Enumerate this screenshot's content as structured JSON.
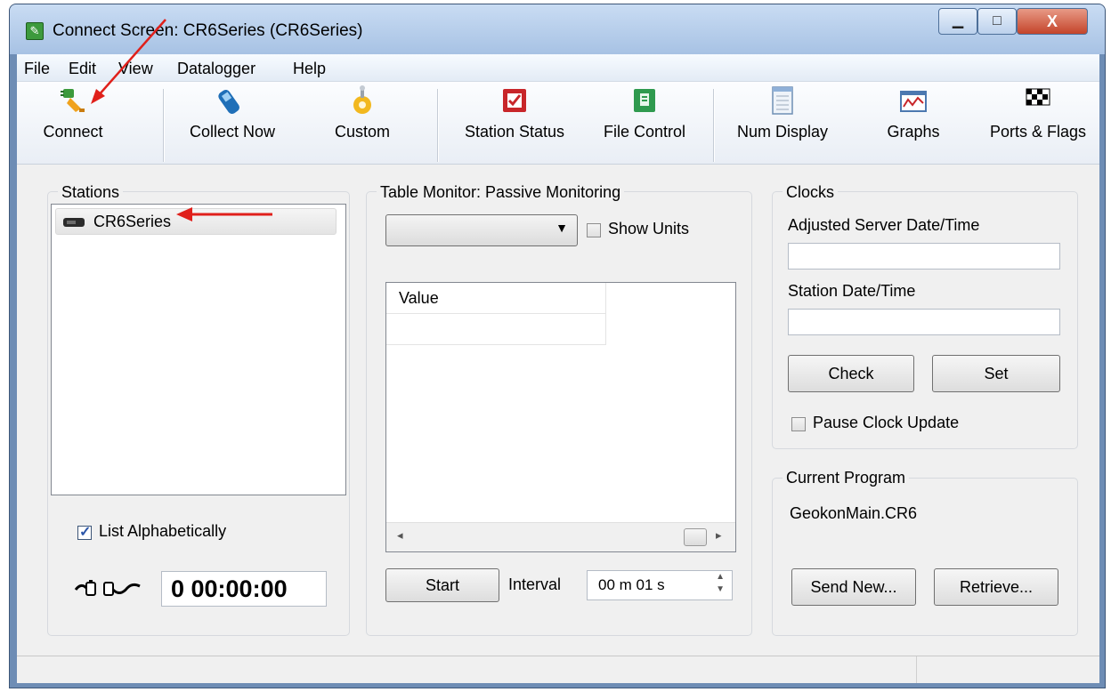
{
  "window": {
    "title": "Connect Screen: CR6Series (CR6Series)",
    "min_glyph": "▁",
    "max_glyph": "□",
    "close_glyph": "X"
  },
  "menu": [
    "File",
    "Edit",
    "View",
    "Datalogger",
    "Help"
  ],
  "toolbar": {
    "connect": "Connect",
    "collect_now": "Collect Now",
    "custom": "Custom",
    "station_status": "Station Status",
    "file_control": "File Control",
    "num_display": "Num Display",
    "graphs": "Graphs",
    "ports_flags": "Ports & Flags"
  },
  "stations": {
    "title": "Stations",
    "items": [
      "CR6Series"
    ],
    "list_alphabetically": "List Alphabetically",
    "timer": "0 00:00:00"
  },
  "table_monitor": {
    "title": "Table Monitor: Passive Monitoring",
    "show_units": "Show Units",
    "column_header": "Value",
    "start_button": "Start",
    "interval_label": "Interval",
    "interval_value": "00 m 01 s"
  },
  "clocks": {
    "title": "Clocks",
    "adjusted_label": "Adjusted Server Date/Time",
    "adjusted_value": "",
    "station_label": "Station Date/Time",
    "station_value": "",
    "check_button": "Check",
    "set_button": "Set",
    "pause_label": "Pause Clock Update"
  },
  "current_program": {
    "title": "Current Program",
    "program_name": "GeokonMain.CR6",
    "send_new_button": "Send New...",
    "retrieve_button": "Retrieve..."
  },
  "colors": {
    "accent_arrow": "#e0201b",
    "window_frame": "#6e8db5"
  }
}
